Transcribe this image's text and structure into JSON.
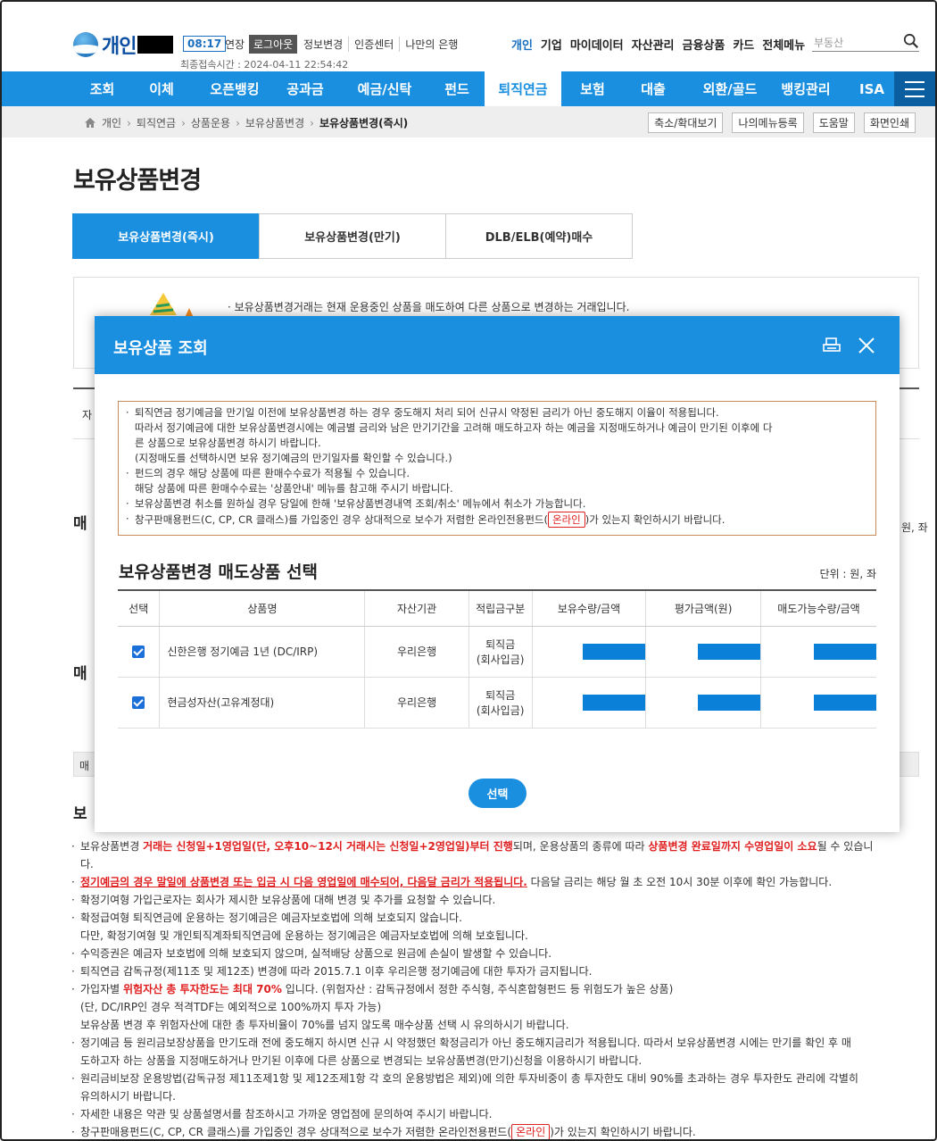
{
  "header": {
    "logo_text": "개인",
    "timer": "08:17",
    "extend": "연장",
    "logout": "로그아웃",
    "links": [
      "정보변경",
      "인증센터",
      "나만의 은행"
    ],
    "last_login": "최종접속시간 :  2024-04-11  22:54:42",
    "right_menu": [
      "개인",
      "기업",
      "마이데이터",
      "자산관리",
      "금융상품",
      "카드",
      "전체메뉴"
    ],
    "search_placeholder": "부동산"
  },
  "nav": {
    "items": [
      "조회",
      "이체",
      "오픈뱅킹",
      "공과금",
      "예금/신탁",
      "펀드",
      "퇴직연금",
      "보험",
      "대출",
      "외환/골드",
      "뱅킹관리",
      "ISA"
    ],
    "active_index": 6
  },
  "breadcrumb": {
    "items": [
      "개인",
      "퇴직연금",
      "상품운용",
      "보유상품변경",
      "보유상품변경(즉시)"
    ],
    "buttons": [
      "축소/확대보기",
      "나의메뉴등록",
      "도움말",
      "화면인쇄"
    ]
  },
  "page": {
    "title": "보유상품변경",
    "tabs": [
      "보유상품변경(즉시)",
      "보유상품변경(만기)",
      "DLB/ELB(예약)매수"
    ],
    "info_text": "· 보유상품변경거래는 현재 운용중인 상품을 매도하여 다른 상품으로 변경하는 거래입니다.",
    "frag_1": "자",
    "frag_2": "매",
    "frag_3": "매",
    "frag_4": "매",
    "frag_5": "보",
    "frag_unit": "원, 좌"
  },
  "notes": {
    "n1a": "보유상품변경 ",
    "n1b": "거래는 신청일+1영업일(단, 오후10~12시 거래시는 신청일+2영업일)부터 진행",
    "n1c": "되며, 운용상품의 종류에 따라 ",
    "n1d": "상품변경 완료일까지 수영업일이 소요",
    "n1e": "될 수 있습니",
    "n1f": "다.",
    "n2a": "정기예금의 경우 말일에 상품변경 또는 입금 시 다음 영업일에 매수되어, 다음달 금리가 적용됩니다.",
    "n2b": " 다음달 금리는 해당 월 초 오전 10시 30분 이후에 확인 가능합니다.",
    "n3": "확정기여형 가입근로자는 회사가 제시한 보유상품에 대해 변경 및 추가를 요청할 수 있습니다.",
    "n4": "확정급여형 퇴직연금에 운용하는 정기예금은 예금자보호법에 의해 보호되지 않습니다.",
    "n4b": "다만, 확정기여형 및 개인퇴직계좌퇴직연금에 운용하는 정기예금은 예금자보호법에 의해 보호됩니다.",
    "n5": "수익증권은 예금자 보호법에 의해 보호되지 않으며, 실적배당 상품으로 원금에 손실이 발생할 수 있습니다.",
    "n6": "퇴직연금 감독규정(제11조 및 제12조) 변경에 따라 2015.7.1 이후 우리은행 정기예금에 대한 투자가 금지됩니다.",
    "n7a": "가입자별 ",
    "n7b": "위험자산 총 투자한도는 최대 70%",
    "n7c": " 입니다. (위험자산 : 감독규정에서 정한 주식형, 주식혼합형펀드 등 위험도가 높은 상품)",
    "n7d": "(단, DC/IRP인 경우 적격TDF는 예외적으로 100%까지 투자 가능)",
    "n7e": "보유상품 변경 후 위험자산에 대한 총 투자비율이 70%를 넘지 않도록 매수상품 선택 시 유의하시기 바랍니다.",
    "n8": "정기예금 등 원리금보장상품을 만기도래 전에 중도해지 하시면 신규 시 약정했던 확정금리가 아닌 중도해지금리가 적용됩니다. 따라서 보유상품변경 시에는 만기를 확인 후 매",
    "n8b": "도하고자 하는 상품을 지정매도하거나 만기된 이후에 다른 상품으로 변경되는 보유상품변경(만기)신청을 이용하시기 바랍니다.",
    "n9": "원리금비보장 운용방법(감독규정 제11조제1항 및 제12조제1항 각 호의 운용방법은 제외)에 의한 투자비중이 총 투자한도 대비 90%를 초과하는 경우 투자한도 관리에 각별히",
    "n9b": "유의하시기 바랍니다.",
    "n10": "자세한 내용은 약관 및 상품설명서를 참조하시고 가까운 영업점에 문의하여 주시기 바랍니다.",
    "n11a": "창구판매용펀드(C, CP, CR 클래스)를 가입중인 경우 상대적으로 보수가 저렴한 온라인전용펀드(",
    "n11tag": "온라인",
    "n11b": ")가 있는지 확인하시기 바랍니다."
  },
  "modal": {
    "title": "보유상품 조회",
    "notice": {
      "l1": "퇴직연금 정기예금을 만기일 이전에 보유상품변경 하는 경우 중도해지 처리 되어 신규시 약정된 금리가 아닌 중도해지 이율이 적용됩니다.",
      "l2": "따라서 정기예금에 대한 보유상품변경시에는 예금별 금리와 남은 만기기간을 고려해 매도하고자 하는 예금을 지정매도하거나 예금이 만기된 이후에 다",
      "l3": "른 상품으로 보유상품변경 하시기 바랍니다.",
      "l4": "(지정매도를 선택하시면 보유 정기예금의 만기일자를 확인할 수 있습니다.)",
      "l5": "펀드의 경우 해당 상품에 따른 환매수수료가 적용될 수 있습니다.",
      "l6": "해당 상품에 따른 환매수수료는 '상품안내' 메뉴를 참고해 주시기 바랍니다.",
      "l7": "보유상품변경 취소를 원하실 경우 당일에 한해 '보유상품변경내역 조회/취소' 메뉴에서 취소가 가능합니다.",
      "l8a": "창구판매용펀드(C, CP, CR 클래스)를 가입중인 경우 상대적으로 보수가 저렴한 온라인전용펀드(",
      "l8tag": "온라인",
      "l8b": ")가 있는지 확인하시기 바랍니다."
    },
    "section_title": "보유상품변경 매도상품 선택",
    "unit": "단위 : 원, 좌",
    "columns": [
      "선택",
      "상품명",
      "자산기관",
      "적립금구분",
      "보유수량/금액",
      "평가금액(원)",
      "매도가능수량/금액"
    ],
    "rows": [
      {
        "name": "신한은행 정기예금 1년 (DC/IRP)",
        "institution": "우리은행",
        "type1": "퇴직금",
        "type2": "(회사입금)"
      },
      {
        "name": "현금성자산(고유계정대)",
        "institution": "우리은행",
        "type1": "퇴직금",
        "type2": "(회사입금)"
      }
    ],
    "select_button": "선택"
  },
  "colors": {
    "brand": "#1a8fe0",
    "nav_dark": "#0b5fa0",
    "red": "#e02020",
    "mask": "#0b80d8"
  }
}
